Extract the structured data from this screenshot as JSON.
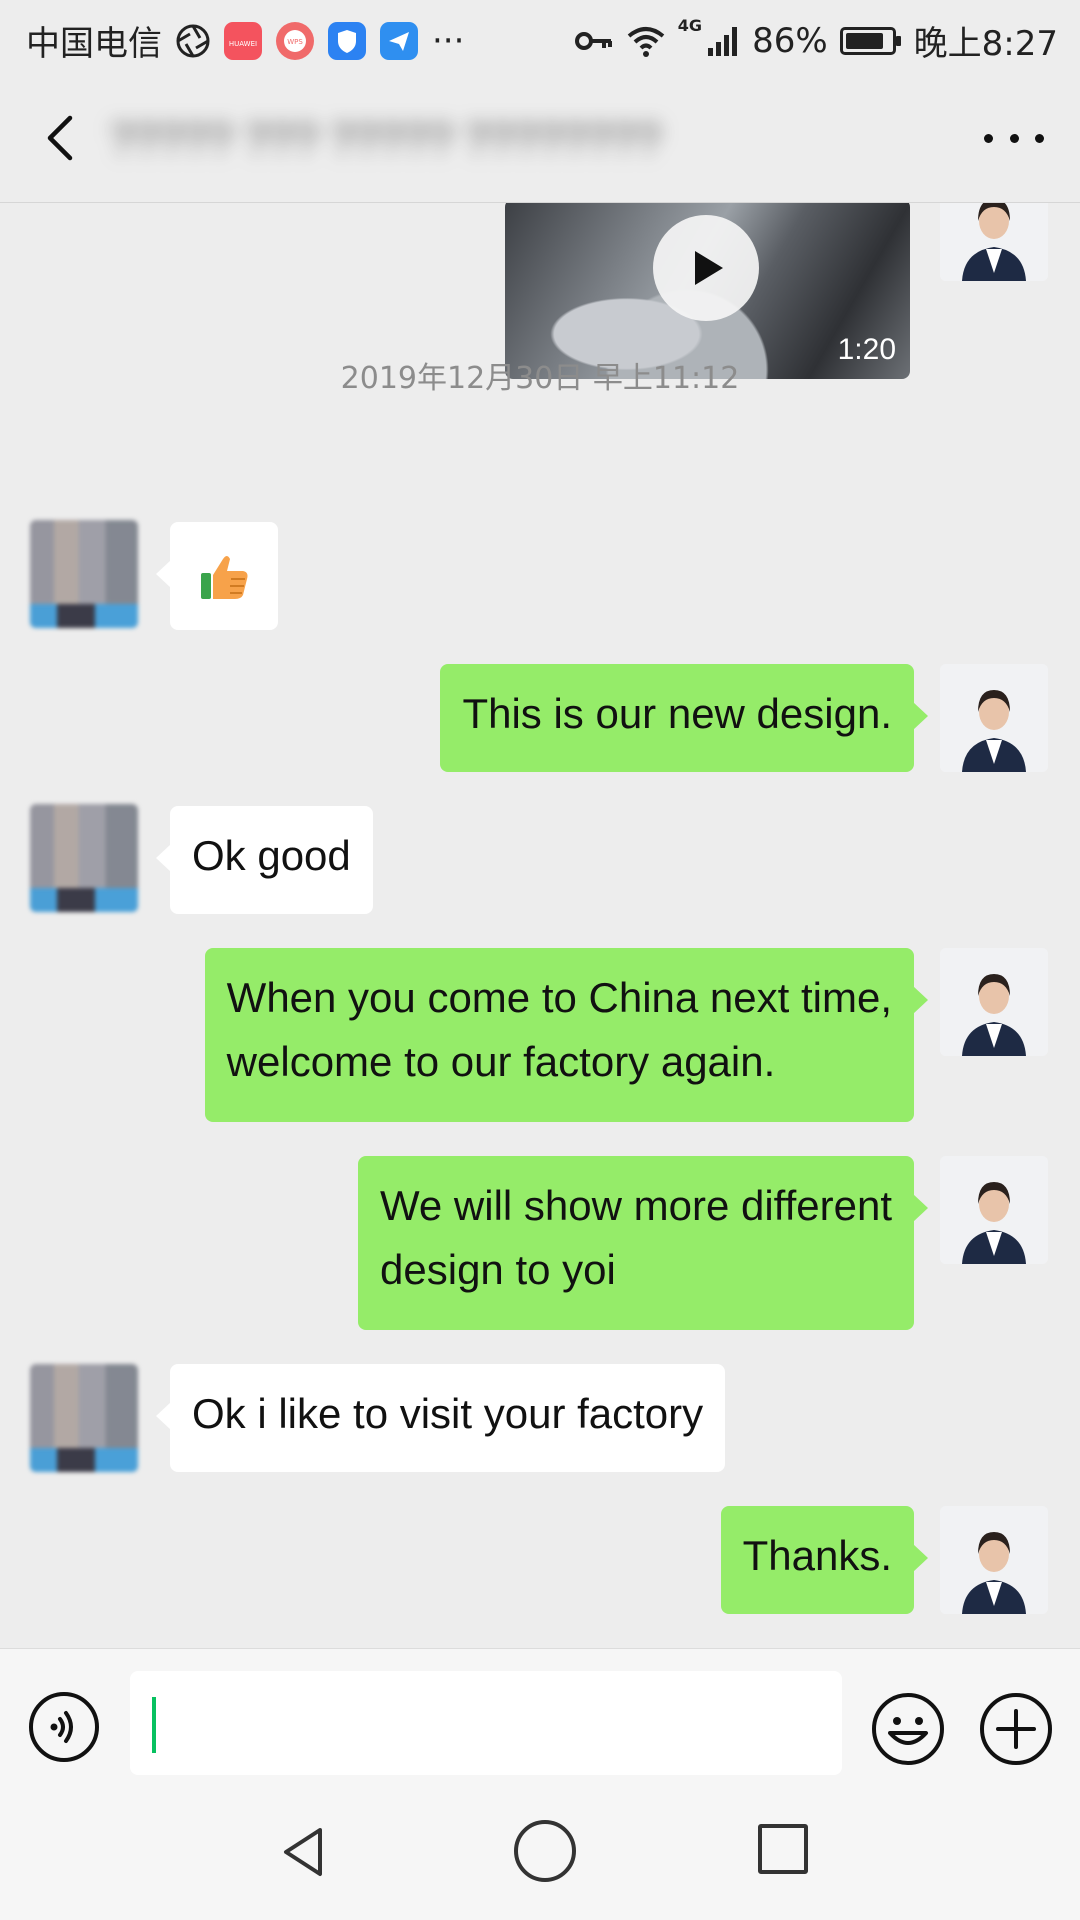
{
  "status_bar": {
    "carrier": "中国电信",
    "more": "···",
    "network": "4G",
    "battery_percent": "86%",
    "battery_level": 0.86,
    "time": "晚上8:27",
    "app_icon_labels": [
      "HUAWEI",
      "WPS"
    ],
    "app_icon_colors": [
      "#f4535e",
      "#f06a6a",
      "#2c82f2",
      "#2f8ff0"
    ]
  },
  "header": {
    "title": "?????  ??? ????? ????????",
    "icons": [
      "back-arrow-icon",
      "more-icon"
    ]
  },
  "video_message": {
    "duration": "1:20"
  },
  "timestamp": "2019年12月30日 早上11:12",
  "messages": [
    {
      "sender": "them",
      "type": "emoji",
      "text": "👍"
    },
    {
      "sender": "me",
      "type": "text",
      "text": "This is our new design."
    },
    {
      "sender": "them",
      "type": "text",
      "text": "Ok  good"
    },
    {
      "sender": "me",
      "type": "text",
      "lines": [
        "When you come to China next time,",
        "welcome to our factory again."
      ]
    },
    {
      "sender": "me",
      "type": "text",
      "lines": [
        "We will show more different",
        "design to yoi"
      ]
    },
    {
      "sender": "them",
      "type": "text",
      "text": "Ok  i like to visit  your factory"
    },
    {
      "sender": "me",
      "type": "text",
      "text": "Thanks."
    }
  ],
  "input": {
    "value": "",
    "icons": [
      "voice-icon",
      "emoji-icon",
      "plus-icon"
    ]
  },
  "colors": {
    "my_bubble": "#95ec69",
    "their_bubble": "#ffffff",
    "background": "#ededed",
    "caret": "#07c160"
  }
}
